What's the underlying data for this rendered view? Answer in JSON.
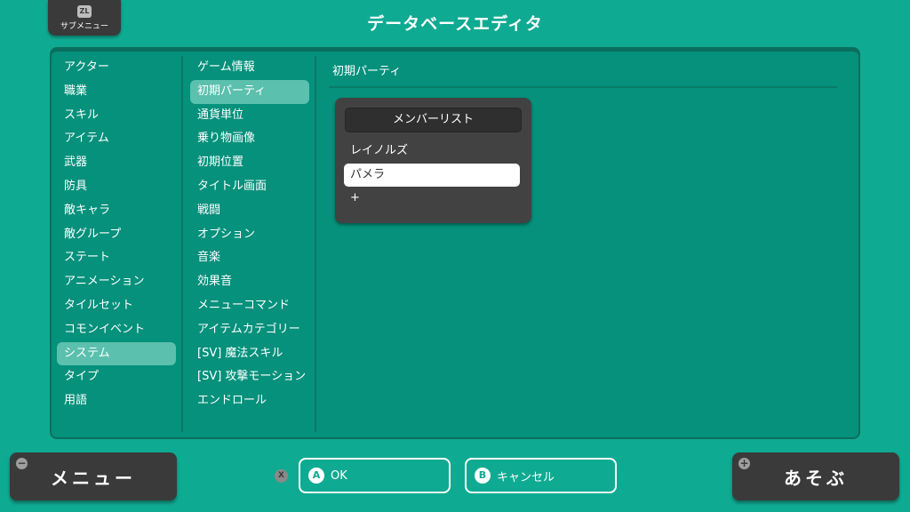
{
  "header": {
    "submenu_icon": "ZL",
    "submenu_label": "サブメニュー",
    "title": "データベースエディタ"
  },
  "categories": [
    {
      "label": "アクター",
      "selected": false
    },
    {
      "label": "職業",
      "selected": false
    },
    {
      "label": "スキル",
      "selected": false
    },
    {
      "label": "アイテム",
      "selected": false
    },
    {
      "label": "武器",
      "selected": false
    },
    {
      "label": "防具",
      "selected": false
    },
    {
      "label": "敵キャラ",
      "selected": false
    },
    {
      "label": "敵グループ",
      "selected": false
    },
    {
      "label": "ステート",
      "selected": false
    },
    {
      "label": "アニメーション",
      "selected": false
    },
    {
      "label": "タイルセット",
      "selected": false
    },
    {
      "label": "コモンイベント",
      "selected": false
    },
    {
      "label": "システム",
      "selected": true
    },
    {
      "label": "タイプ",
      "selected": false
    },
    {
      "label": "用語",
      "selected": false
    }
  ],
  "system_items": [
    {
      "label": "ゲーム情報",
      "selected": false
    },
    {
      "label": "初期パーティ",
      "selected": true
    },
    {
      "label": "通貨単位",
      "selected": false
    },
    {
      "label": "乗り物画像",
      "selected": false
    },
    {
      "label": "初期位置",
      "selected": false
    },
    {
      "label": "タイトル画面",
      "selected": false
    },
    {
      "label": "戦闘",
      "selected": false
    },
    {
      "label": "オプション",
      "selected": false
    },
    {
      "label": "音楽",
      "selected": false
    },
    {
      "label": "効果音",
      "selected": false
    },
    {
      "label": "メニューコマンド",
      "selected": false
    },
    {
      "label": "アイテムカテゴリー",
      "selected": false
    },
    {
      "label": "[SV] 魔法スキル",
      "selected": false
    },
    {
      "label": "[SV] 攻撃モーション",
      "selected": false
    },
    {
      "label": "エンドロール",
      "selected": false
    }
  ],
  "content": {
    "section_title": "初期パーティ",
    "member_list": {
      "title": "メンバーリスト",
      "members": [
        {
          "name": "レイノルズ",
          "selected": false
        },
        {
          "name": "パメラ",
          "selected": true
        }
      ],
      "add_label": "+"
    }
  },
  "footer": {
    "menu_icon": "−",
    "menu_label": "メニュー",
    "x_icon": "X",
    "ok_key": "A",
    "ok_label": "OK",
    "cancel_key": "B",
    "cancel_label": "キャンセル",
    "play_icon": "+",
    "play_label": "あそぶ"
  },
  "colors": {
    "background": "#0faa92",
    "panel": "#05917c",
    "selected_item": "#5bc0ad",
    "dark_button": "#3a3a3a"
  }
}
